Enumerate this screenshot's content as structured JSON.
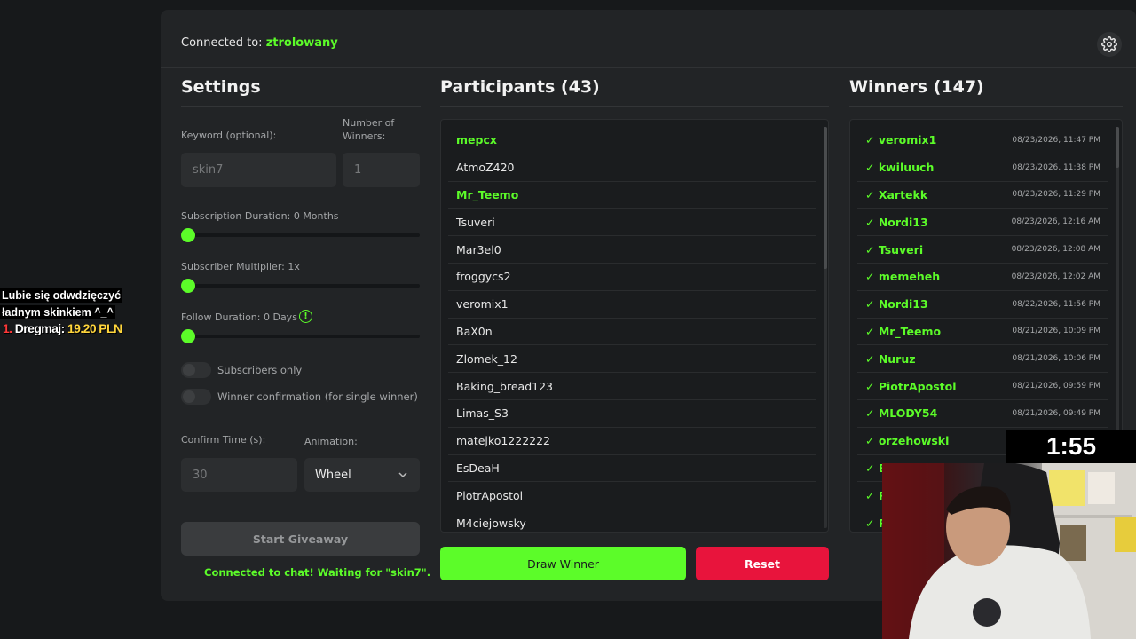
{
  "overlay": {
    "donation_message_line1": "Lubie się odwdzięczyć",
    "donation_message_line2": "ładnym skinkiem ^_^",
    "donation_rank": "1.",
    "donation_name": "Dregmaj:",
    "donation_amount": "19.20 PLN",
    "timer": "1:55"
  },
  "header": {
    "connected_label": "Connected to:",
    "channel": "ztrolowany",
    "settings_icon": "gear-icon"
  },
  "settings": {
    "title": "Settings",
    "keyword_label": "Keyword (optional):",
    "keyword_value": "skin7",
    "winners_label_line1": "Number of",
    "winners_label_line2": "Winners:",
    "winners_value": "1",
    "sub_duration_label": "Subscription Duration: 0 Months",
    "sub_multiplier_label": "Subscriber Multiplier: 1x",
    "follow_duration_label": "Follow Duration:  0  Days",
    "subscribers_only_label": "Subscribers only",
    "winner_confirmation_label": "Winner confirmation (for single winner)",
    "confirm_time_label": "Confirm Time (s):",
    "confirm_time_value": "30",
    "animation_label": "Animation:",
    "animation_value": "Wheel",
    "start_button": "Start Giveaway",
    "status": "Connected to chat! Waiting for \"skin7\".",
    "accent_color": "#5cfc29"
  },
  "participants": {
    "title": "Participants (43)",
    "items": [
      {
        "name": "mepcx",
        "sub": true
      },
      {
        "name": "AtmoZ420",
        "sub": false
      },
      {
        "name": "Mr_Teemo",
        "sub": true
      },
      {
        "name": "Tsuveri",
        "sub": false
      },
      {
        "name": "Mar3el0",
        "sub": false
      },
      {
        "name": "froggycs2",
        "sub": false
      },
      {
        "name": "veromix1",
        "sub": false
      },
      {
        "name": "BaX0n",
        "sub": false
      },
      {
        "name": "Zlomek_12",
        "sub": false
      },
      {
        "name": "Baking_bread123",
        "sub": false
      },
      {
        "name": "Limas_S3",
        "sub": false
      },
      {
        "name": "matejko1222222",
        "sub": false
      },
      {
        "name": "EsDeaH",
        "sub": false
      },
      {
        "name": "PiotrApostol",
        "sub": false
      },
      {
        "name": "M4ciejowsky",
        "sub": false
      }
    ],
    "draw_button": "Draw Winner",
    "reset_button": "Reset"
  },
  "winners": {
    "title": "Winners (147)",
    "items": [
      {
        "name": "✓ veromix1",
        "time": "08/23/2026, 11:47 PM"
      },
      {
        "name": "✓ kwiluuch",
        "time": "08/23/2026, 11:38 PM"
      },
      {
        "name": "✓ Xartekk",
        "time": "08/23/2026, 11:29 PM"
      },
      {
        "name": "✓ Nordi13",
        "time": "08/23/2026, 12:16 AM"
      },
      {
        "name": "✓ Tsuveri",
        "time": "08/23/2026, 12:08 AM"
      },
      {
        "name": "✓ memeheh",
        "time": "08/23/2026, 12:02 AM"
      },
      {
        "name": "✓ Nordi13",
        "time": "08/22/2026, 11:56 PM"
      },
      {
        "name": "✓ Mr_Teemo",
        "time": "08/21/2026, 10:09 PM"
      },
      {
        "name": "✓ Nuruz",
        "time": "08/21/2026, 10:06 PM"
      },
      {
        "name": "✓ PiotrApostol",
        "time": "08/21/2026, 09:59 PM"
      },
      {
        "name": "✓ MLODY54",
        "time": "08/21/2026, 09:49 PM"
      },
      {
        "name": "✓ orzehowski",
        "time": ""
      },
      {
        "name": "✓ Bl",
        "time": ""
      },
      {
        "name": "✓ R",
        "time": ""
      },
      {
        "name": "✓ R",
        "time": ""
      }
    ]
  }
}
